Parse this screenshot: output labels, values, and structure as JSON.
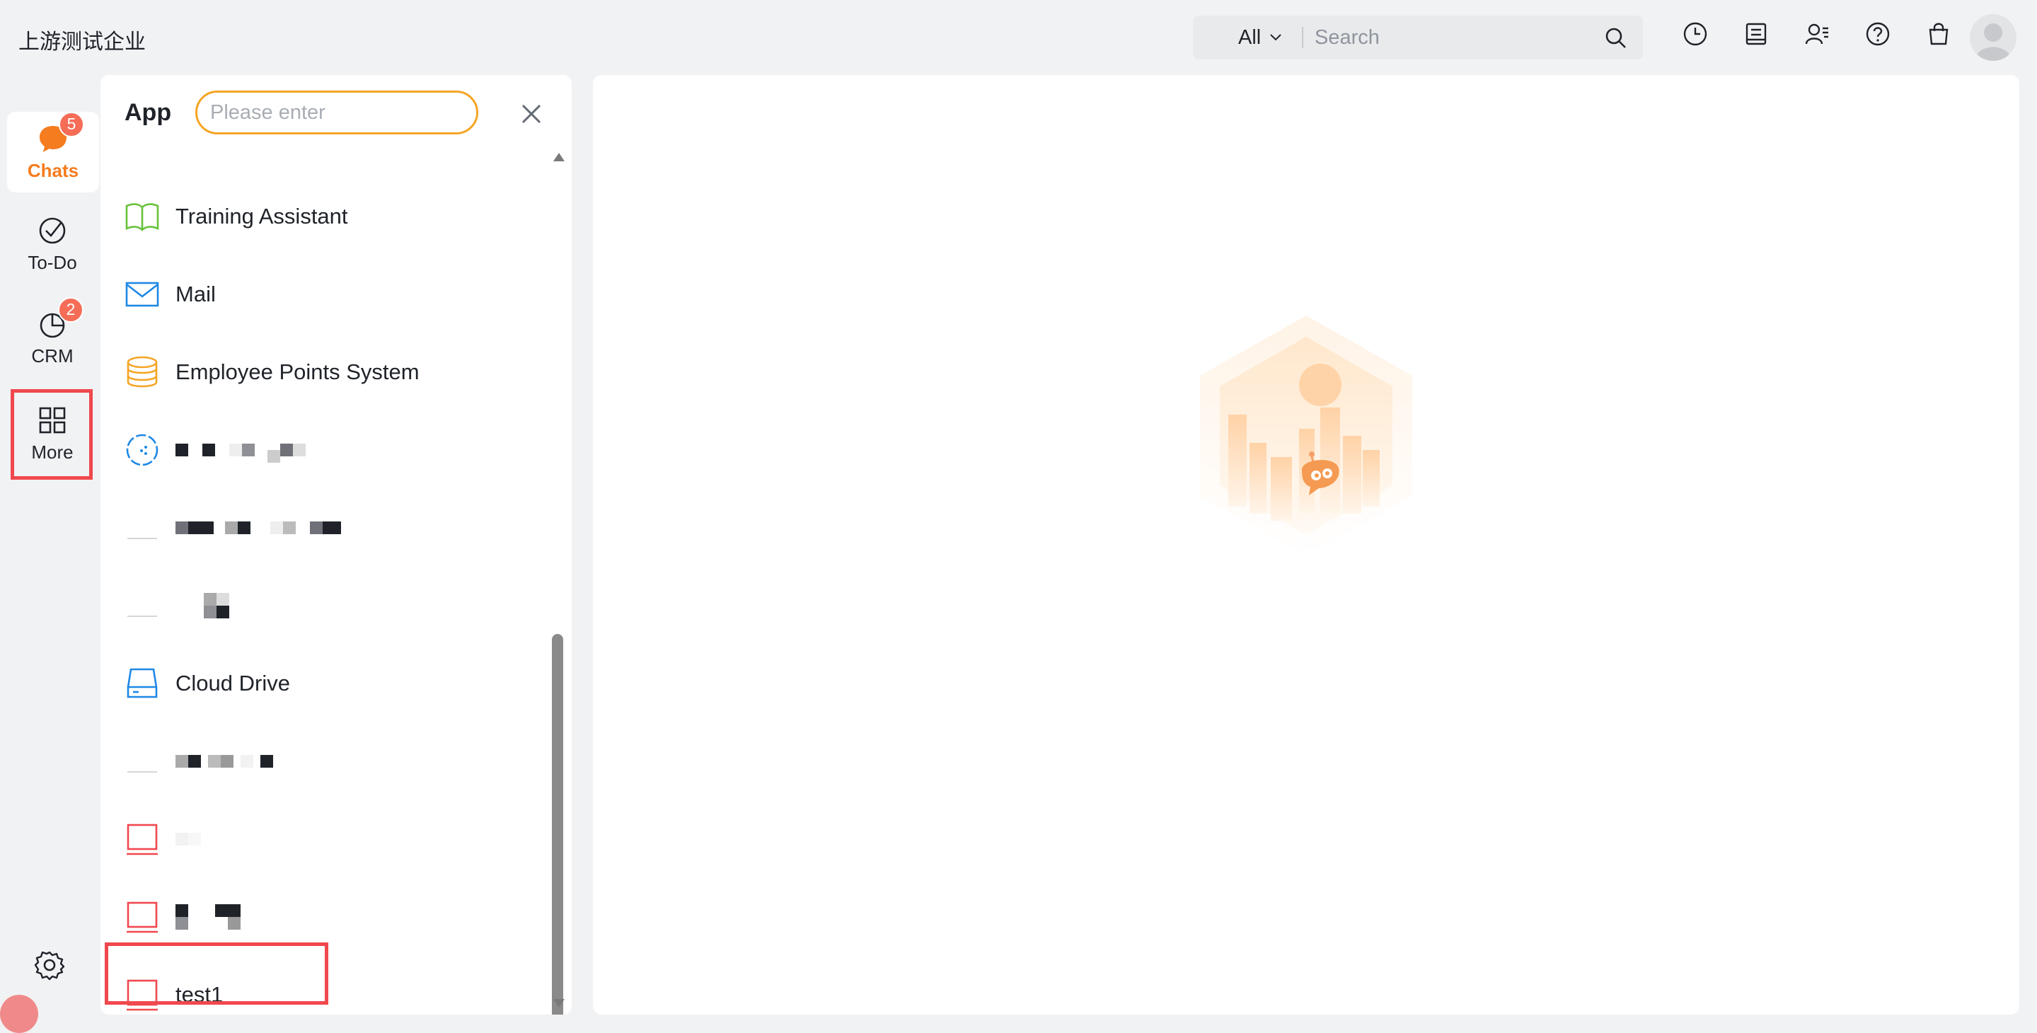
{
  "header": {
    "org_name": "上游测试企业",
    "search": {
      "scope": "All",
      "placeholder": "Search"
    },
    "icons": [
      "history-icon",
      "notes-icon",
      "contacts-icon",
      "help-icon",
      "shop-icon"
    ]
  },
  "nav": {
    "items": [
      {
        "label": "Chats",
        "badge": "5",
        "icon": "chat-bubble-icon",
        "active": true
      },
      {
        "label": "To-Do",
        "badge": "",
        "icon": "check-circle-icon",
        "active": false
      },
      {
        "label": "CRM",
        "badge": "2",
        "icon": "pie-chart-icon",
        "active": false
      },
      {
        "label": "More",
        "badge": "",
        "icon": "grid-icon",
        "active": false
      }
    ]
  },
  "panel": {
    "title": "App",
    "search_placeholder": "Please enter",
    "apps": [
      {
        "label": "Training Assistant",
        "icon": "book-icon"
      },
      {
        "label": "Mail",
        "icon": "mail-icon"
      },
      {
        "label": "Employee Points System",
        "icon": "database-icon"
      },
      {
        "label": "",
        "icon": "dotted-circle-icon"
      },
      {
        "label": "",
        "icon": "blank-icon"
      },
      {
        "label": "",
        "icon": "blank-icon"
      },
      {
        "label": "Cloud Drive",
        "icon": "drive-icon"
      },
      {
        "label": "",
        "icon": "blank-icon"
      },
      {
        "label": "",
        "icon": "monitor-icon"
      },
      {
        "label": "",
        "icon": "monitor-icon"
      },
      {
        "label": "test1",
        "icon": "monitor-icon"
      }
    ]
  },
  "colors": {
    "accent": "#f57c1f",
    "badge": "#f56c57",
    "highlight": "#f0484e",
    "search_border": "#f5a524"
  }
}
